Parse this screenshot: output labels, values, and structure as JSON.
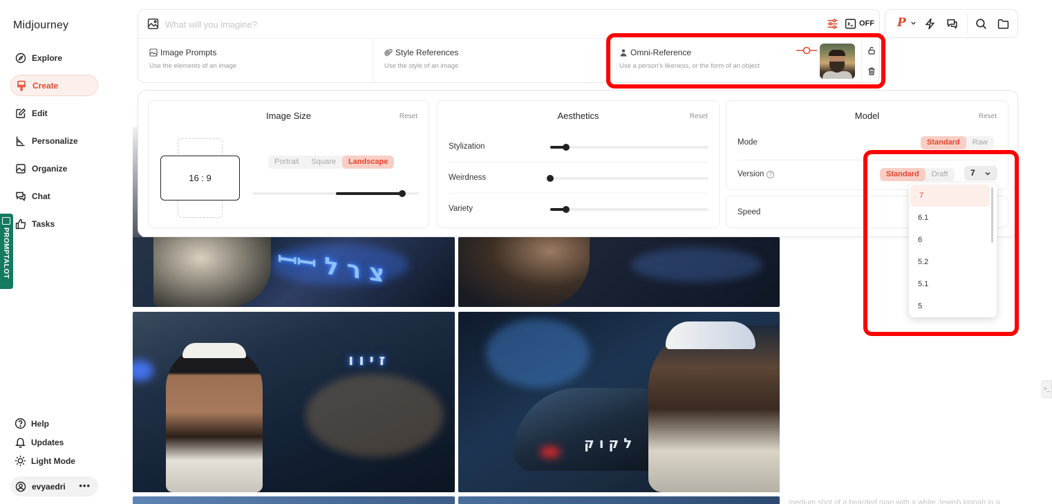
{
  "app": {
    "title": "Midjourney"
  },
  "sidebar": {
    "items": [
      {
        "label": "Explore",
        "icon": "compass-icon"
      },
      {
        "label": "Create",
        "icon": "brush-icon",
        "active": true
      },
      {
        "label": "Edit",
        "icon": "edit-icon"
      },
      {
        "label": "Personalize",
        "icon": "personalize-icon"
      },
      {
        "label": "Organize",
        "icon": "image-stack-icon"
      },
      {
        "label": "Chat",
        "icon": "chat-icon"
      },
      {
        "label": "Tasks",
        "icon": "thumbs-up-icon"
      }
    ],
    "bottom": [
      {
        "label": "Help",
        "icon": "help-icon"
      },
      {
        "label": "Updates",
        "icon": "bell-icon"
      },
      {
        "label": "Light Mode",
        "icon": "sun-icon"
      }
    ],
    "user": {
      "name": "evyaedri",
      "more": "•••"
    }
  },
  "extension": {
    "label": "PROMPTALOT"
  },
  "prompt": {
    "placeholder": "What will you imagine?",
    "raw_toggle": "OFF"
  },
  "references": [
    {
      "title": "Image Prompts",
      "subtitle": "Use the elements of an image"
    },
    {
      "title": "Style References",
      "subtitle": "Use the style of an image"
    },
    {
      "title": "Omni-Reference",
      "subtitle": "Use a person's likeness, or the form of an object"
    }
  ],
  "toolbar": {
    "brand_letter": "P"
  },
  "settings": {
    "image_size": {
      "title": "Image Size",
      "reset": "Reset",
      "ratio": "16 : 9",
      "orientations": [
        "Portrait",
        "Square",
        "Landscape"
      ],
      "selected": "Landscape",
      "slider_value": 0.9
    },
    "aesthetics": {
      "title": "Aesthetics",
      "reset": "Reset",
      "rows": [
        {
          "label": "Stylization",
          "value": 0.1
        },
        {
          "label": "Weirdness",
          "value": 0.0
        },
        {
          "label": "Variety",
          "value": 0.1
        }
      ]
    },
    "model": {
      "title": "Model",
      "reset": "Reset",
      "mode_label": "Mode",
      "modes": [
        "Standard",
        "Raw"
      ],
      "mode_selected": "Standard",
      "version_label": "Version",
      "version_help": "?",
      "version_modes": [
        "Standard",
        "Draft"
      ],
      "version_mode_selected": "Standard",
      "version_value": "7",
      "speed_label": "Speed"
    }
  },
  "version_dropdown": {
    "options": [
      "7",
      "6.1",
      "6",
      "5.2",
      "5.1",
      "5"
    ],
    "selected": "7"
  },
  "gallery": {
    "caption_cut": "medium shot of a bearded man with a white Jewish kippah in a"
  },
  "colors": {
    "accent": "#e4472f",
    "accent_bg": "#f8cec5",
    "highlight_box": "#ff0000"
  }
}
